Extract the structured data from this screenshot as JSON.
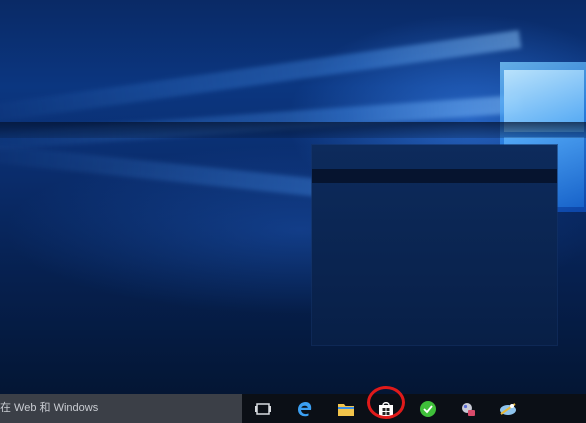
{
  "taskbar": {
    "search_placeholder": "在 Web 和 Windows",
    "pinned": [
      {
        "name": "task-view-icon"
      },
      {
        "name": "edge-icon"
      },
      {
        "name": "file-explorer-icon"
      },
      {
        "name": "store-icon"
      },
      {
        "name": "green-app-icon"
      },
      {
        "name": "app-icon"
      },
      {
        "name": "app-icon"
      }
    ]
  },
  "colors": {
    "highlight": "#e01a1a",
    "taskbar": "#0b0f16",
    "search_box": "#3b3f47"
  }
}
